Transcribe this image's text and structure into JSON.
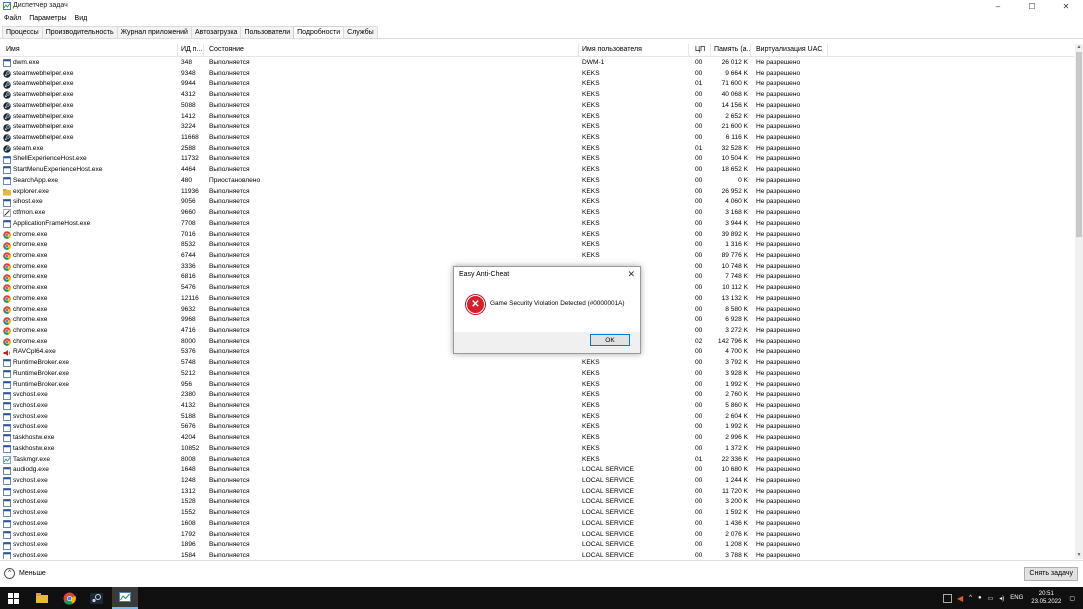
{
  "window": {
    "title": "Диспетчер задач",
    "minimize": "–",
    "maximize": "☐",
    "close": "✕"
  },
  "menu": [
    "Файл",
    "Параметры",
    "Вид"
  ],
  "tabs": [
    "Процессы",
    "Производительность",
    "Журнал приложений",
    "Автозагрузка",
    "Пользователи",
    "Подробности",
    "Службы"
  ],
  "active_tab": "Подробности",
  "columns": [
    "Имя",
    "ИД п...",
    "Состояние",
    "Имя пользователя",
    "ЦП",
    "Память (а...",
    "Виртуализация UAC"
  ],
  "rows": [
    {
      "icon": "window-icon",
      "name": "dwm.exe",
      "pid": "348",
      "state": "Выполняется",
      "user": "DWM-1",
      "cpu": "00",
      "mem": "26 012 K",
      "uac": "Не разрешено"
    },
    {
      "icon": "steam-icon",
      "name": "steamwebhelper.exe",
      "pid": "9348",
      "state": "Выполняется",
      "user": "KEKS",
      "cpu": "00",
      "mem": "9 664 K",
      "uac": "Не разрешено"
    },
    {
      "icon": "steam-icon",
      "name": "steamwebhelper.exe",
      "pid": "9944",
      "state": "Выполняется",
      "user": "KEKS",
      "cpu": "01",
      "mem": "71 600 K",
      "uac": "Не разрешено"
    },
    {
      "icon": "steam-icon",
      "name": "steamwebhelper.exe",
      "pid": "4312",
      "state": "Выполняется",
      "user": "KEKS",
      "cpu": "00",
      "mem": "40 068 K",
      "uac": "Не разрешено"
    },
    {
      "icon": "steam-icon",
      "name": "steamwebhelper.exe",
      "pid": "5088",
      "state": "Выполняется",
      "user": "KEKS",
      "cpu": "00",
      "mem": "14 156 K",
      "uac": "Не разрешено"
    },
    {
      "icon": "steam-icon",
      "name": "steamwebhelper.exe",
      "pid": "1412",
      "state": "Выполняется",
      "user": "KEKS",
      "cpu": "00",
      "mem": "2 652 K",
      "uac": "Не разрешено"
    },
    {
      "icon": "steam-icon",
      "name": "steamwebhelper.exe",
      "pid": "3224",
      "state": "Выполняется",
      "user": "KEKS",
      "cpu": "00",
      "mem": "21 600 K",
      "uac": "Не разрешено"
    },
    {
      "icon": "steam-icon",
      "name": "steamwebhelper.exe",
      "pid": "11668",
      "state": "Выполняется",
      "user": "KEKS",
      "cpu": "00",
      "mem": "6 116 K",
      "uac": "Не разрешено"
    },
    {
      "icon": "steam-icon",
      "name": "steam.exe",
      "pid": "2588",
      "state": "Выполняется",
      "user": "KEKS",
      "cpu": "01",
      "mem": "32 528 K",
      "uac": "Не разрешено"
    },
    {
      "icon": "window-icon",
      "name": "ShellExperienceHost.exe",
      "pid": "11732",
      "state": "Выполняется",
      "user": "KEKS",
      "cpu": "00",
      "mem": "10 504 K",
      "uac": "Не разрешено"
    },
    {
      "icon": "window-icon",
      "name": "StartMenuExperienceHost.exe",
      "pid": "4464",
      "state": "Выполняется",
      "user": "KEKS",
      "cpu": "00",
      "mem": "18 652 K",
      "uac": "Не разрешено"
    },
    {
      "icon": "window-icon",
      "name": "SearchApp.exe",
      "pid": "480",
      "state": "Приостановлено",
      "user": "KEKS",
      "cpu": "00",
      "mem": "0 K",
      "uac": "Не разрешено"
    },
    {
      "icon": "folder-icon",
      "name": "explorer.exe",
      "pid": "11936",
      "state": "Выполняется",
      "user": "KEKS",
      "cpu": "00",
      "mem": "26 952 K",
      "uac": "Не разрешено"
    },
    {
      "icon": "window-icon",
      "name": "sihost.exe",
      "pid": "9056",
      "state": "Выполняется",
      "user": "KEKS",
      "cpu": "00",
      "mem": "4 060 K",
      "uac": "Не разрешено"
    },
    {
      "icon": "pen-icon",
      "name": "ctfmon.exe",
      "pid": "9660",
      "state": "Выполняется",
      "user": "KEKS",
      "cpu": "00",
      "mem": "3 168 K",
      "uac": "Не разрешено"
    },
    {
      "icon": "window-icon",
      "name": "ApplicationFrameHost.exe",
      "pid": "7708",
      "state": "Выполняется",
      "user": "KEKS",
      "cpu": "00",
      "mem": "3 944 K",
      "uac": "Не разрешено"
    },
    {
      "icon": "chrome-icon",
      "name": "chrome.exe",
      "pid": "7016",
      "state": "Выполняется",
      "user": "KEKS",
      "cpu": "00",
      "mem": "39 892 K",
      "uac": "Не разрешено"
    },
    {
      "icon": "chrome-icon",
      "name": "chrome.exe",
      "pid": "8532",
      "state": "Выполняется",
      "user": "KEKS",
      "cpu": "00",
      "mem": "1 316 K",
      "uac": "Не разрешено"
    },
    {
      "icon": "chrome-icon",
      "name": "chrome.exe",
      "pid": "6744",
      "state": "Выполняется",
      "user": "KEKS",
      "cpu": "00",
      "mem": "89 776 K",
      "uac": "Не разрешено"
    },
    {
      "icon": "chrome-icon",
      "name": "chrome.exe",
      "pid": "3336",
      "state": "Выполняется",
      "user": "",
      "cpu": "00",
      "mem": "10 748 K",
      "uac": "Не разрешено"
    },
    {
      "icon": "chrome-icon",
      "name": "chrome.exe",
      "pid": "6816",
      "state": "Выполняется",
      "user": "",
      "cpu": "00",
      "mem": "7 748 K",
      "uac": "Не разрешено"
    },
    {
      "icon": "chrome-icon",
      "name": "chrome.exe",
      "pid": "5476",
      "state": "Выполняется",
      "user": "",
      "cpu": "00",
      "mem": "10 112 K",
      "uac": "Не разрешено"
    },
    {
      "icon": "chrome-icon",
      "name": "chrome.exe",
      "pid": "12116",
      "state": "Выполняется",
      "user": "",
      "cpu": "00",
      "mem": "13 132 K",
      "uac": "Не разрешено"
    },
    {
      "icon": "chrome-icon",
      "name": "chrome.exe",
      "pid": "9632",
      "state": "Выполняется",
      "user": "",
      "cpu": "00",
      "mem": "8 580 K",
      "uac": "Не разрешено"
    },
    {
      "icon": "chrome-icon",
      "name": "chrome.exe",
      "pid": "9968",
      "state": "Выполняется",
      "user": "",
      "cpu": "00",
      "mem": "6 928 K",
      "uac": "Не разрешено"
    },
    {
      "icon": "chrome-icon",
      "name": "chrome.exe",
      "pid": "4716",
      "state": "Выполняется",
      "user": "",
      "cpu": "00",
      "mem": "3 272 K",
      "uac": "Не разрешено"
    },
    {
      "icon": "chrome-icon",
      "name": "chrome.exe",
      "pid": "8000",
      "state": "Выполняется",
      "user": "",
      "cpu": "02",
      "mem": "142 796 K",
      "uac": "Не разрешено"
    },
    {
      "icon": "speaker-icon",
      "name": "RAVCpl64.exe",
      "pid": "5376",
      "state": "Выполняется",
      "user": "KEKS",
      "cpu": "00",
      "mem": "4 700 K",
      "uac": "Не разрешено"
    },
    {
      "icon": "window-icon",
      "name": "RuntimeBroker.exe",
      "pid": "5748",
      "state": "Выполняется",
      "user": "KEKS",
      "cpu": "00",
      "mem": "3 792 K",
      "uac": "Не разрешено"
    },
    {
      "icon": "window-icon",
      "name": "RuntimeBroker.exe",
      "pid": "5212",
      "state": "Выполняется",
      "user": "KEKS",
      "cpu": "00",
      "mem": "3 928 K",
      "uac": "Не разрешено"
    },
    {
      "icon": "window-icon",
      "name": "RuntimeBroker.exe",
      "pid": "956",
      "state": "Выполняется",
      "user": "KEKS",
      "cpu": "00",
      "mem": "1 992 K",
      "uac": "Не разрешено"
    },
    {
      "icon": "window-icon",
      "name": "svchost.exe",
      "pid": "2380",
      "state": "Выполняется",
      "user": "KEKS",
      "cpu": "00",
      "mem": "2 760 K",
      "uac": "Не разрешено"
    },
    {
      "icon": "window-icon",
      "name": "svchost.exe",
      "pid": "4132",
      "state": "Выполняется",
      "user": "KEKS",
      "cpu": "00",
      "mem": "5 860 K",
      "uac": "Не разрешено"
    },
    {
      "icon": "window-icon",
      "name": "svchost.exe",
      "pid": "5188",
      "state": "Выполняется",
      "user": "KEKS",
      "cpu": "00",
      "mem": "2 604 K",
      "uac": "Не разрешено"
    },
    {
      "icon": "window-icon",
      "name": "svchost.exe",
      "pid": "5676",
      "state": "Выполняется",
      "user": "KEKS",
      "cpu": "00",
      "mem": "1 992 K",
      "uac": "Не разрешено"
    },
    {
      "icon": "window-icon",
      "name": "taskhostw.exe",
      "pid": "4204",
      "state": "Выполняется",
      "user": "KEKS",
      "cpu": "00",
      "mem": "2 996 K",
      "uac": "Не разрешено"
    },
    {
      "icon": "window-icon",
      "name": "taskhostw.exe",
      "pid": "10852",
      "state": "Выполняется",
      "user": "KEKS",
      "cpu": "00",
      "mem": "1 372 K",
      "uac": "Не разрешено"
    },
    {
      "icon": "taskmgr-icon",
      "name": "Taskmgr.exe",
      "pid": "8008",
      "state": "Выполняется",
      "user": "KEKS",
      "cpu": "01",
      "mem": "22 336 K",
      "uac": "Не разрешено"
    },
    {
      "icon": "window-icon",
      "name": "audiodg.exe",
      "pid": "1648",
      "state": "Выполняется",
      "user": "LOCAL SERVICE",
      "cpu": "00",
      "mem": "10 680 K",
      "uac": "Не разрешено"
    },
    {
      "icon": "window-icon",
      "name": "svchost.exe",
      "pid": "1248",
      "state": "Выполняется",
      "user": "LOCAL SERVICE",
      "cpu": "00",
      "mem": "1 244 K",
      "uac": "Не разрешено"
    },
    {
      "icon": "window-icon",
      "name": "svchost.exe",
      "pid": "1312",
      "state": "Выполняется",
      "user": "LOCAL SERVICE",
      "cpu": "00",
      "mem": "11 720 K",
      "uac": "Не разрешено"
    },
    {
      "icon": "window-icon",
      "name": "svchost.exe",
      "pid": "1528",
      "state": "Выполняется",
      "user": "LOCAL SERVICE",
      "cpu": "00",
      "mem": "3 200 K",
      "uac": "Не разрешено"
    },
    {
      "icon": "window-icon",
      "name": "svchost.exe",
      "pid": "1552",
      "state": "Выполняется",
      "user": "LOCAL SERVICE",
      "cpu": "00",
      "mem": "1 592 K",
      "uac": "Не разрешено"
    },
    {
      "icon": "window-icon",
      "name": "svchost.exe",
      "pid": "1608",
      "state": "Выполняется",
      "user": "LOCAL SERVICE",
      "cpu": "00",
      "mem": "1 436 K",
      "uac": "Не разрешено"
    },
    {
      "icon": "window-icon",
      "name": "svchost.exe",
      "pid": "1792",
      "state": "Выполняется",
      "user": "LOCAL SERVICE",
      "cpu": "00",
      "mem": "2 076 K",
      "uac": "Не разрешено"
    },
    {
      "icon": "window-icon",
      "name": "svchost.exe",
      "pid": "1896",
      "state": "Выполняется",
      "user": "LOCAL SERVICE",
      "cpu": "00",
      "mem": "1 208 K",
      "uac": "Не разрешено"
    },
    {
      "icon": "window-icon",
      "name": "svchost.exe",
      "pid": "1584",
      "state": "Выполняется",
      "user": "LOCAL SERVICE",
      "cpu": "00",
      "mem": "3 788 K",
      "uac": "Не разрешено"
    }
  ],
  "footer": {
    "less_label": "Меньше",
    "end_task_label": "Снять задачу"
  },
  "dialog": {
    "title": "Easy Anti-Cheat",
    "message": "Game Security Violation Detected (#0000001A)",
    "ok_label": "OK",
    "close": "✕"
  },
  "taskbar": {
    "language": "ENG",
    "time": "20:51",
    "date": "23.05.2022"
  },
  "colors": {
    "accent": "#0078d7",
    "error": "#d81e2b",
    "taskbar": "#101010"
  }
}
